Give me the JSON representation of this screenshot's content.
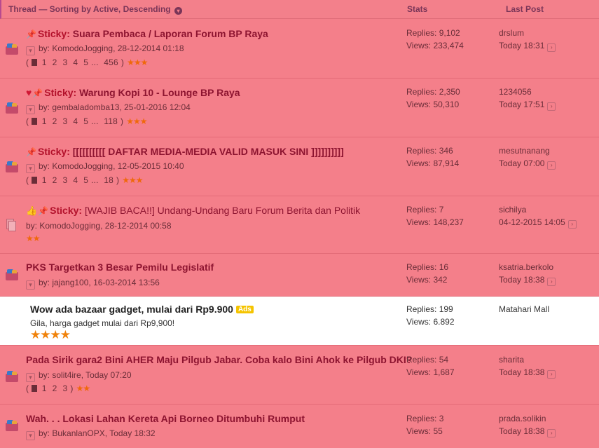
{
  "header": {
    "thread_label": "Thread — Sorting by Active, Descending",
    "stats_label": "Stats",
    "last_post_label": "Last Post"
  },
  "threads": [
    {
      "prefix": "Sticky:",
      "title": "Suara Pembaca / Laporan Forum BP Raya",
      "by": "by:",
      "author": "KomodoJogging, 28-12-2014 01:18",
      "pages": [
        "1",
        "2",
        "3",
        "4",
        "5",
        "...",
        "456"
      ],
      "stars": "★★★",
      "replies": "Replies: 9,102",
      "views": "Views: 233,474",
      "last_user": "drslum",
      "last_time": "Today 18:31"
    },
    {
      "prefix": "Sticky:",
      "title": "Warung Kopi 10 - Lounge BP Raya",
      "by": "by:",
      "author": "gembaladomba13, 25-01-2016 12:04",
      "pages": [
        "1",
        "2",
        "3",
        "4",
        "5",
        "...",
        "118"
      ],
      "stars": "★★★",
      "replies": "Replies: 2,350",
      "views": "Views: 50,310",
      "last_user": "1234056",
      "last_time": "Today 17:51"
    },
    {
      "prefix": "Sticky:",
      "title": "[[[[[[[[[[ DAFTAR MEDIA-MEDIA VALID MASUK SINI ]]]]]]]]]]",
      "by": "by:",
      "author": "KomodoJogging, 12-05-2015 10:40",
      "pages": [
        "1",
        "2",
        "3",
        "4",
        "5",
        "...",
        "18"
      ],
      "stars": "★★★",
      "replies": "Replies: 346",
      "views": "Views: 87,914",
      "last_user": "mesutnanang",
      "last_time": "Today 07:00"
    },
    {
      "prefix": "Sticky:",
      "title": "[WAJIB BACA!!] Undang-Undang Baru Forum Berita dan Politik",
      "by": "by:",
      "author": "KomodoJogging, 28-12-2014 00:58",
      "stars": "★★",
      "replies": "Replies: 7",
      "views": "Views: 148,237",
      "last_user": "sichilya",
      "last_time": "04-12-2015 14:05"
    },
    {
      "title": "PKS Targetkan 3 Besar Pemilu Legislatif",
      "by": "by:",
      "author": "jajang100, 16-03-2014 13:56",
      "replies": "Replies: 16",
      "views": "Views: 342",
      "last_user": "ksatria.berkolo",
      "last_time": "Today 18:38"
    },
    {
      "title": "Pada Sirik gara2 Bini AHER Maju Pilgub Jabar. Coba kalo Bini Ahok ke Pilgub DKI?",
      "by": "by:",
      "author": "solit4ire, Today 07:20",
      "pages": [
        "1",
        "2",
        "3"
      ],
      "stars": "★★",
      "replies": "Replies: 54",
      "views": "Views: 1,687",
      "last_user": "sharita",
      "last_time": "Today 18:38"
    },
    {
      "title": "Wah. . . Lokasi Lahan Kereta Api Borneo Ditumbuhi Rumput",
      "by": "by:",
      "author": "BukanlanOPX, Today 18:32",
      "replies": "Replies: 3",
      "views": "Views: 55",
      "last_user": "prada.solikin",
      "last_time": "Today 18:38"
    }
  ],
  "ad": {
    "title": "Wow ada bazaar gadget, mulai dari Rp9.900",
    "badge": "Ads",
    "desc": "Gila, harga gadget mulai dari Rp9,900!",
    "stars": "★★★★",
    "replies": "Replies: 199",
    "views": "Views: 6.892",
    "last_user": "Matahari Mall"
  },
  "colors": {
    "background": "#f47f8a",
    "title": "#8d1430",
    "sticky": "#b3112b",
    "star": "#f0680a"
  }
}
